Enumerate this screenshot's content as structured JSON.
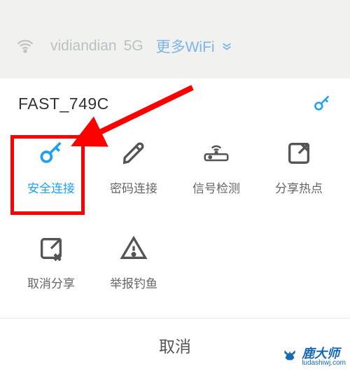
{
  "backdrop": {
    "wifi_name": "vidiandian",
    "band": "5G",
    "more_wifi_label": "更多WiFi"
  },
  "sheet": {
    "title": "FAST_749C",
    "cancel_label": "取消"
  },
  "tiles": [
    {
      "label": "安全连接",
      "icon": "key-icon",
      "active": true
    },
    {
      "label": "密码连接",
      "icon": "pencil-icon",
      "active": false
    },
    {
      "label": "信号检测",
      "icon": "router-icon",
      "active": false
    },
    {
      "label": "分享热点",
      "icon": "share-icon",
      "active": false
    },
    {
      "label": "取消分享",
      "icon": "share-cancel-icon",
      "active": false
    },
    {
      "label": "举报钓鱼",
      "icon": "warning-icon",
      "active": false
    }
  ],
  "watermark": {
    "text": "鹿大师",
    "url_text": "ludashiwj.com"
  },
  "colors": {
    "accent": "#1ea1f2",
    "danger": "#ff0000",
    "brand": "#1668b8"
  }
}
